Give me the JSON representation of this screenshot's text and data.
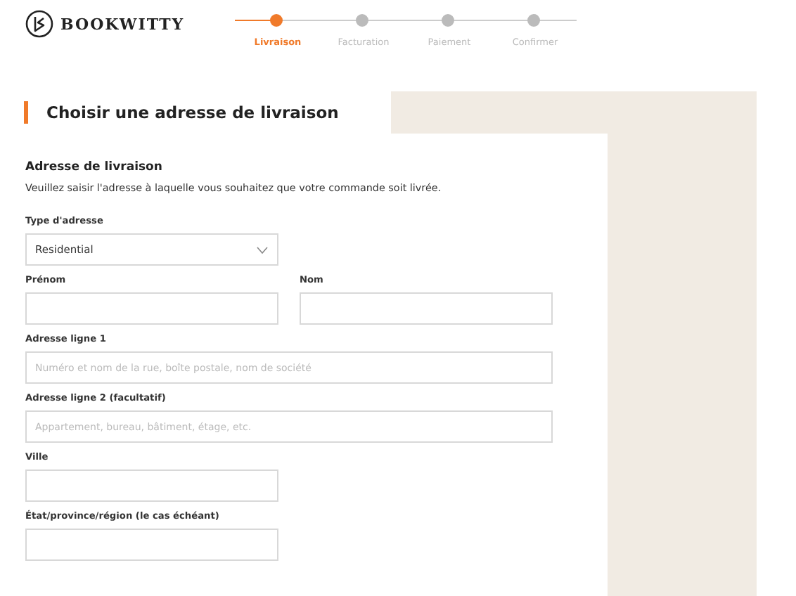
{
  "brand": {
    "name": "BOOKWITTY"
  },
  "steps": [
    {
      "label": "Livraison",
      "selected": true
    },
    {
      "label": "Facturation",
      "selected": false
    },
    {
      "label": "Paiement",
      "selected": false
    },
    {
      "label": "Confirmer",
      "selected": false
    }
  ],
  "page_title": "Choisir une adresse de livraison",
  "section": {
    "title": "Adresse de livraison",
    "description": "Veuillez saisir l'adresse à laquelle vous souhaitez que votre commande soit livrée."
  },
  "rows": [
    [
      {
        "kind": "select",
        "label": "Type d'adresse",
        "value": "Residential"
      }
    ],
    [
      {
        "kind": "text",
        "label": "Prénom"
      },
      {
        "kind": "text",
        "label": "Nom"
      }
    ],
    [
      {
        "kind": "wide",
        "label": "Adresse ligne 1",
        "placeholder": "Numéro et nom de la rue, boîte postale, nom de société"
      }
    ],
    [
      {
        "kind": "wide",
        "label": "Adresse ligne 2 (facultatif)",
        "placeholder": "Appartement, bureau, bâtiment, étage, etc."
      }
    ],
    [
      {
        "kind": "text",
        "label": "Ville"
      }
    ],
    [
      {
        "kind": "text",
        "label": "État/province/région (le cas échéant)"
      }
    ]
  ]
}
